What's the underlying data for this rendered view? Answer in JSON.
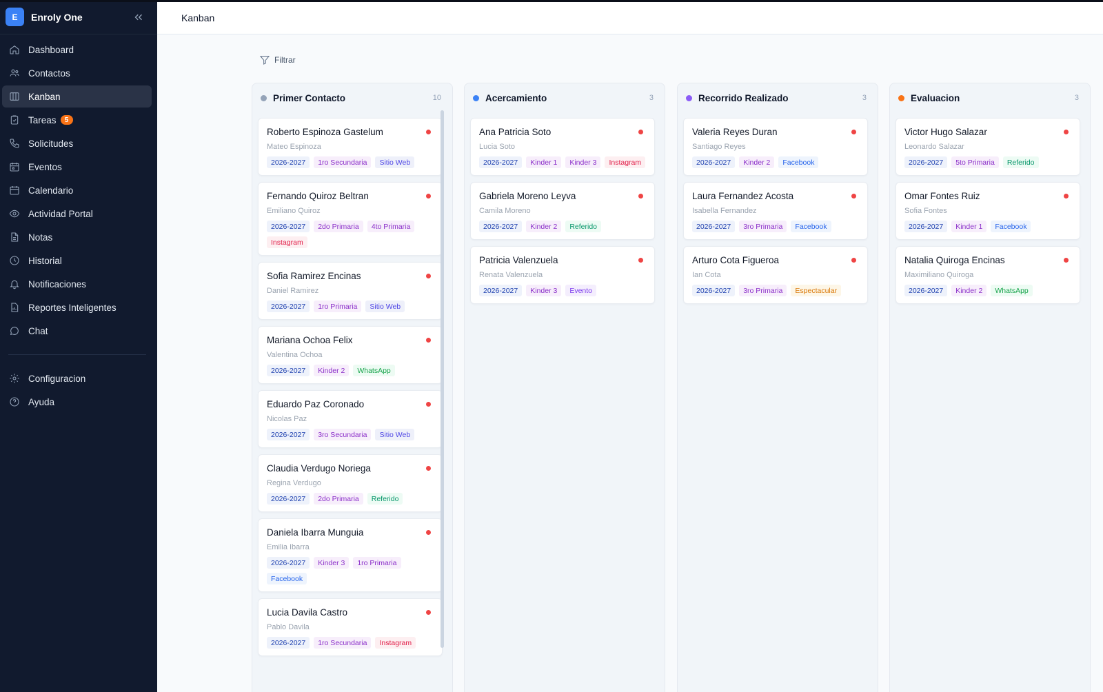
{
  "app": {
    "logo_letter": "E",
    "name": "Enroly One"
  },
  "sidebar": {
    "items": [
      {
        "label": "Dashboard",
        "icon": "home-icon"
      },
      {
        "label": "Contactos",
        "icon": "users-icon"
      },
      {
        "label": "Kanban",
        "icon": "columns-icon",
        "active": true
      },
      {
        "label": "Tareas",
        "icon": "clipboard-icon",
        "badge": "5"
      },
      {
        "label": "Solicitudes",
        "icon": "phone-icon"
      },
      {
        "label": "Eventos",
        "icon": "calendar-event-icon"
      },
      {
        "label": "Calendario",
        "icon": "calendar-icon"
      },
      {
        "label": "Actividad Portal",
        "icon": "eye-icon"
      },
      {
        "label": "Notas",
        "icon": "file-icon"
      },
      {
        "label": "Historial",
        "icon": "clock-icon"
      },
      {
        "label": "Notificaciones",
        "icon": "bell-icon"
      },
      {
        "label": "Reportes Inteligentes",
        "icon": "report-icon"
      },
      {
        "label": "Chat",
        "icon": "chat-icon"
      }
    ],
    "bottom_items": [
      {
        "label": "Configuracion",
        "icon": "gear-icon"
      },
      {
        "label": "Ayuda",
        "icon": "help-icon"
      }
    ]
  },
  "header": {
    "title": "Kanban"
  },
  "toolbar": {
    "filter_label": "Filtrar"
  },
  "colors": {
    "sidebar_bg": "#111a2e",
    "accent": "#3b82f6",
    "priority_dot": "#ef4444"
  },
  "columns": [
    {
      "title": "Primer Contacto",
      "count": "10",
      "color": "#94a3b8",
      "cards": [
        {
          "name": "Roberto Espinoza Gastelum",
          "contact": "Mateo Espinoza",
          "tags": [
            [
              "2026-2027",
              "year"
            ],
            [
              "1ro Secundaria",
              "grade"
            ],
            [
              "Sitio Web",
              "web"
            ]
          ]
        },
        {
          "name": "Fernando Quiroz Beltran",
          "contact": "Emiliano Quiroz",
          "tags": [
            [
              "2026-2027",
              "year"
            ],
            [
              "2do Primaria",
              "grade"
            ],
            [
              "4to Primaria",
              "grade"
            ],
            [
              "Instagram",
              "ig"
            ]
          ]
        },
        {
          "name": "Sofia Ramirez Encinas",
          "contact": "Daniel Ramirez",
          "tags": [
            [
              "2026-2027",
              "year"
            ],
            [
              "1ro Primaria",
              "grade"
            ],
            [
              "Sitio Web",
              "web"
            ]
          ]
        },
        {
          "name": "Mariana Ochoa Felix",
          "contact": "Valentina Ochoa",
          "tags": [
            [
              "2026-2027",
              "year"
            ],
            [
              "Kinder 2",
              "grade"
            ],
            [
              "WhatsApp",
              "wa"
            ]
          ]
        },
        {
          "name": "Eduardo Paz Coronado",
          "contact": "Nicolas Paz",
          "tags": [
            [
              "2026-2027",
              "year"
            ],
            [
              "3ro Secundaria",
              "grade"
            ],
            [
              "Sitio Web",
              "web"
            ]
          ]
        },
        {
          "name": "Claudia Verdugo Noriega",
          "contact": "Regina Verdugo",
          "tags": [
            [
              "2026-2027",
              "year"
            ],
            [
              "2do Primaria",
              "grade"
            ],
            [
              "Referido",
              "ref"
            ]
          ]
        },
        {
          "name": "Daniela Ibarra Munguia",
          "contact": "Emilia Ibarra",
          "tags": [
            [
              "2026-2027",
              "year"
            ],
            [
              "Kinder 3",
              "grade"
            ],
            [
              "1ro Primaria",
              "grade"
            ],
            [
              "Facebook",
              "fb"
            ]
          ]
        },
        {
          "name": "Lucia Davila Castro",
          "contact": "Pablo Davila",
          "tags": [
            [
              "2026-2027",
              "year"
            ],
            [
              "1ro Secundaria",
              "grade"
            ],
            [
              "Instagram",
              "ig"
            ]
          ]
        }
      ]
    },
    {
      "title": "Acercamiento",
      "count": "3",
      "color": "#3b82f6",
      "cards": [
        {
          "name": "Ana Patricia Soto",
          "contact": "Lucia Soto",
          "tags": [
            [
              "2026-2027",
              "year"
            ],
            [
              "Kinder 1",
              "grade"
            ],
            [
              "Kinder 3",
              "grade"
            ],
            [
              "Instagram",
              "ig"
            ]
          ]
        },
        {
          "name": "Gabriela Moreno Leyva",
          "contact": "Camila Moreno",
          "tags": [
            [
              "2026-2027",
              "year"
            ],
            [
              "Kinder 2",
              "grade"
            ],
            [
              "Referido",
              "ref"
            ]
          ]
        },
        {
          "name": "Patricia Valenzuela",
          "contact": "Renata Valenzuela",
          "tags": [
            [
              "2026-2027",
              "year"
            ],
            [
              "Kinder 3",
              "grade"
            ],
            [
              "Evento",
              "evento"
            ]
          ]
        }
      ]
    },
    {
      "title": "Recorrido Realizado",
      "count": "3",
      "color": "#8b5cf6",
      "cards": [
        {
          "name": "Valeria Reyes Duran",
          "contact": "Santiago Reyes",
          "tags": [
            [
              "2026-2027",
              "year"
            ],
            [
              "Kinder 2",
              "grade"
            ],
            [
              "Facebook",
              "fb"
            ]
          ]
        },
        {
          "name": "Laura Fernandez Acosta",
          "contact": "Isabella Fernandez",
          "tags": [
            [
              "2026-2027",
              "year"
            ],
            [
              "3ro Primaria",
              "grade"
            ],
            [
              "Facebook",
              "fb"
            ]
          ]
        },
        {
          "name": "Arturo Cota Figueroa",
          "contact": "Ian Cota",
          "tags": [
            [
              "2026-2027",
              "year"
            ],
            [
              "3ro Primaria",
              "grade"
            ],
            [
              "Espectacular",
              "esp"
            ]
          ]
        }
      ]
    },
    {
      "title": "Evaluacion",
      "count": "3",
      "color": "#f97316",
      "cards": [
        {
          "name": "Victor Hugo Salazar",
          "contact": "Leonardo Salazar",
          "tags": [
            [
              "2026-2027",
              "year"
            ],
            [
              "5to Primaria",
              "grade"
            ],
            [
              "Referido",
              "ref"
            ]
          ]
        },
        {
          "name": "Omar Fontes Ruiz",
          "contact": "Sofia Fontes",
          "tags": [
            [
              "2026-2027",
              "year"
            ],
            [
              "Kinder 1",
              "grade"
            ],
            [
              "Facebook",
              "fb"
            ]
          ]
        },
        {
          "name": "Natalia Quiroga Encinas",
          "contact": "Maximiliano Quiroga",
          "tags": [
            [
              "2026-2027",
              "year"
            ],
            [
              "Kinder 2",
              "grade"
            ],
            [
              "WhatsApp",
              "wa"
            ]
          ]
        }
      ]
    }
  ]
}
